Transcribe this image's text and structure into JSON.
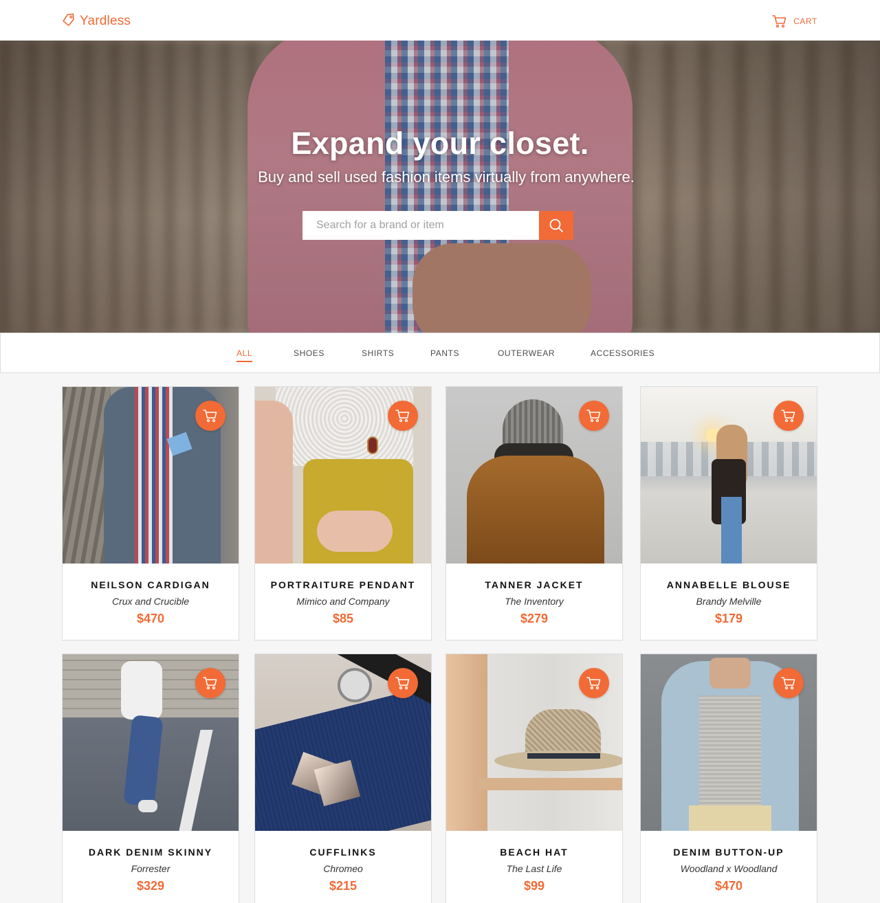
{
  "header": {
    "brand_name": "Yardless",
    "cart_label": "CART",
    "accent_color": "#f26a35"
  },
  "hero": {
    "title": "Expand your closet.",
    "subtitle": "Buy and sell used fashion items virtually from anywhere.",
    "search_placeholder": "Search for a brand or item"
  },
  "categories": {
    "active": "ALL",
    "items": [
      {
        "label": "ALL"
      },
      {
        "label": "SHOES"
      },
      {
        "label": "SHIRTS"
      },
      {
        "label": "PANTS"
      },
      {
        "label": "OUTERWEAR"
      },
      {
        "label": "ACCESSORIES"
      }
    ]
  },
  "products": [
    {
      "name": "NEILSON CARDIGAN",
      "maker": "Crux and Crucible",
      "price": "$470"
    },
    {
      "name": "PORTRAITURE PENDANT",
      "maker": "Mimico and Company",
      "price": "$85"
    },
    {
      "name": "TANNER JACKET",
      "maker": "The Inventory",
      "price": "$279"
    },
    {
      "name": "ANNABELLE BLOUSE",
      "maker": "Brandy Melville",
      "price": "$179"
    },
    {
      "name": "DARK DENIM SKINNY",
      "maker": "Forrester",
      "price": "$329"
    },
    {
      "name": "CUFFLINKS",
      "maker": "Chromeo",
      "price": "$215"
    },
    {
      "name": "BEACH HAT",
      "maker": "The Last Life",
      "price": "$99"
    },
    {
      "name": "DENIM BUTTON-UP",
      "maker": "Woodland x Woodland",
      "price": "$470"
    }
  ],
  "icons": {
    "brand": "tag-icon",
    "cart": "cart-icon",
    "search": "search-icon",
    "add_to_cart": "cart-icon"
  }
}
